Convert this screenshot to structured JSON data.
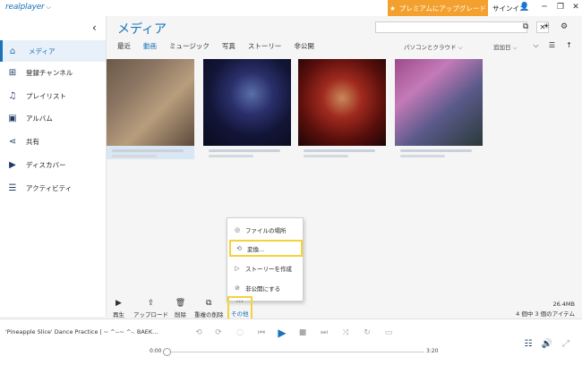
{
  "app": {
    "logo": "realplayer",
    "premium_label": "プレミアムにアップグレード",
    "signin_label": "サインイン"
  },
  "sidebar": {
    "items": [
      {
        "label": "メディア",
        "icon": "home-icon"
      },
      {
        "label": "登録チャンネル",
        "icon": "add-square-icon"
      },
      {
        "label": "プレイリスト",
        "icon": "music-note-icon"
      },
      {
        "label": "アルバム",
        "icon": "album-icon"
      },
      {
        "label": "共有",
        "icon": "share-icon"
      },
      {
        "label": "ディスカバー",
        "icon": "play-circle-icon"
      },
      {
        "label": "アクティビティ",
        "icon": "sliders-icon"
      }
    ]
  },
  "main": {
    "title": "メディア",
    "tabs": [
      "最近",
      "動画",
      "ミュージック",
      "写真",
      "ストーリー",
      "非公開"
    ],
    "active_tab": "動画",
    "sort_source": "パソコンとクラウド",
    "sort_order": "追加日"
  },
  "context_menu": {
    "items": [
      {
        "label": "ファイルの場所",
        "icon": "location-icon"
      },
      {
        "label": "変換...",
        "icon": "convert-icon"
      },
      {
        "label": "ストーリーを作成",
        "icon": "story-icon"
      },
      {
        "label": "非公開にする",
        "icon": "hide-icon"
      }
    ]
  },
  "toolbar": {
    "play": "再生",
    "upload": "アップロード",
    "delete": "削除",
    "dup_delete": "重複の削除",
    "more": "その他",
    "more_icon": "···",
    "size": "26.4MB",
    "count": "4 個中 3 個のアイテム"
  },
  "player": {
    "now_playing": "'Pineapple Slice' Dance Practice | ~ ^--~ ^-. BAEK...",
    "time_current": "0:00",
    "time_total": "3:20",
    "progress": 0
  },
  "colors": {
    "accent": "#1a73b8",
    "premium": "#f3a02e",
    "highlight": "#f4d23c"
  }
}
